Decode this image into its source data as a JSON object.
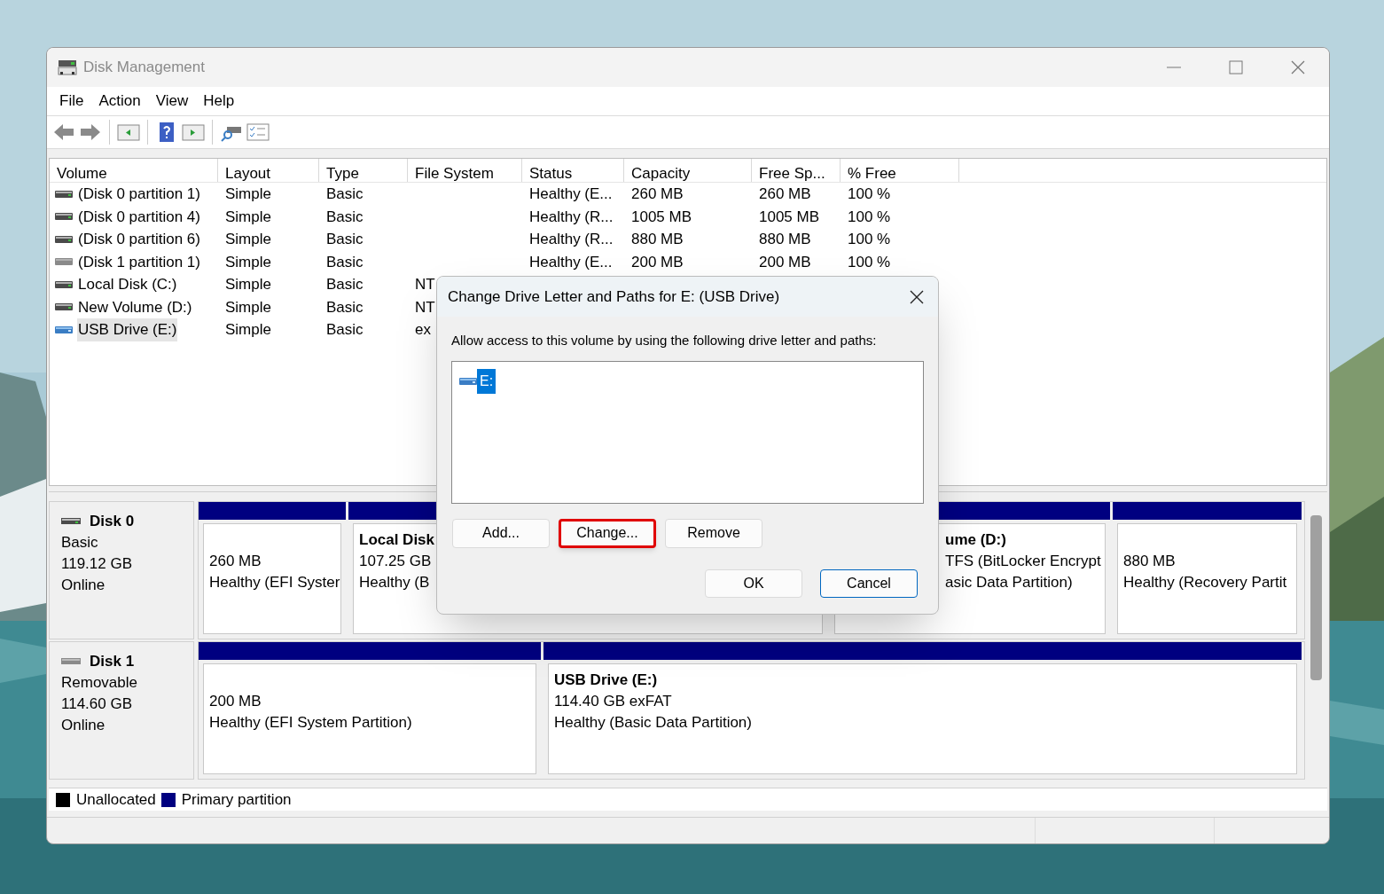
{
  "window": {
    "title": "Disk Management"
  },
  "menu": [
    "File",
    "Action",
    "View",
    "Help"
  ],
  "table": {
    "columns": [
      "Volume",
      "Layout",
      "Type",
      "File System",
      "Status",
      "Capacity",
      "Free Sp...",
      "% Free"
    ],
    "rows": [
      {
        "kind": "disk",
        "selected": false,
        "cells": [
          "(Disk 0 partition 1)",
          "Simple",
          "Basic",
          "",
          "Healthy (E...",
          "260 MB",
          "260 MB",
          "100 %"
        ]
      },
      {
        "kind": "disk",
        "selected": false,
        "cells": [
          "(Disk 0 partition 4)",
          "Simple",
          "Basic",
          "",
          "Healthy (R...",
          "1005 MB",
          "1005 MB",
          "100 %"
        ]
      },
      {
        "kind": "disk",
        "selected": false,
        "cells": [
          "(Disk 0 partition 6)",
          "Simple",
          "Basic",
          "",
          "Healthy (R...",
          "880 MB",
          "880 MB",
          "100 %"
        ]
      },
      {
        "kind": "removable",
        "selected": false,
        "cells": [
          "(Disk 1 partition 1)",
          "Simple",
          "Basic",
          "",
          "Healthy (E...",
          "200 MB",
          "200 MB",
          "100 %"
        ]
      },
      {
        "kind": "disk",
        "selected": false,
        "cells": [
          "Local Disk (C:)",
          "Simple",
          "Basic",
          "NT"
        ]
      },
      {
        "kind": "disk",
        "selected": false,
        "cells": [
          "New Volume (D:)",
          "Simple",
          "Basic",
          "NT"
        ]
      },
      {
        "kind": "usb",
        "selected": true,
        "cells": [
          "USB Drive (E:)",
          "Simple",
          "Basic",
          "ex"
        ]
      }
    ]
  },
  "disks": [
    {
      "kind": "disk",
      "name": "Disk 0",
      "type": "Basic",
      "size": "119.12 GB",
      "status": "Online",
      "partitions": [
        {
          "lines": [
            "260 MB",
            "Healthy (EFI Syster"
          ]
        },
        {
          "title": "Local Disk",
          "lines": [
            "107.25 GB",
            "Healthy (B"
          ]
        },
        {
          "title": "ume  (D:)",
          "lines": [
            "TFS (BitLocker Encrypt",
            "asic Data Partition)"
          ]
        },
        {
          "lines": [
            "880 MB",
            "Healthy (Recovery Partit"
          ]
        }
      ]
    },
    {
      "kind": "removable",
      "name": "Disk 1",
      "type": "Removable",
      "size": "114.60 GB",
      "status": "Online",
      "partitions": [
        {
          "lines": [
            "200 MB",
            "Healthy (EFI System Partition)"
          ]
        },
        {
          "title": "USB Drive  (E:)",
          "lines": [
            "114.40 GB exFAT",
            "Healthy (Basic Data Partition)"
          ]
        }
      ]
    }
  ],
  "legend": [
    {
      "label": "Unallocated",
      "color": "#000000"
    },
    {
      "label": "Primary partition",
      "color": "#000080"
    }
  ],
  "dialog": {
    "title": "Change Drive Letter and Paths for E: (USB Drive)",
    "prompt": "Allow access to this volume by using the following drive letter and paths:",
    "paths": [
      {
        "label": "E:",
        "selected": true
      }
    ],
    "actions": [
      {
        "label": "Add...",
        "annotated": false
      },
      {
        "label": "Change...",
        "annotated": true
      },
      {
        "label": "Remove",
        "annotated": false
      }
    ],
    "buttons": [
      {
        "label": "OK",
        "default": false
      },
      {
        "label": "Cancel",
        "default": true
      }
    ]
  }
}
